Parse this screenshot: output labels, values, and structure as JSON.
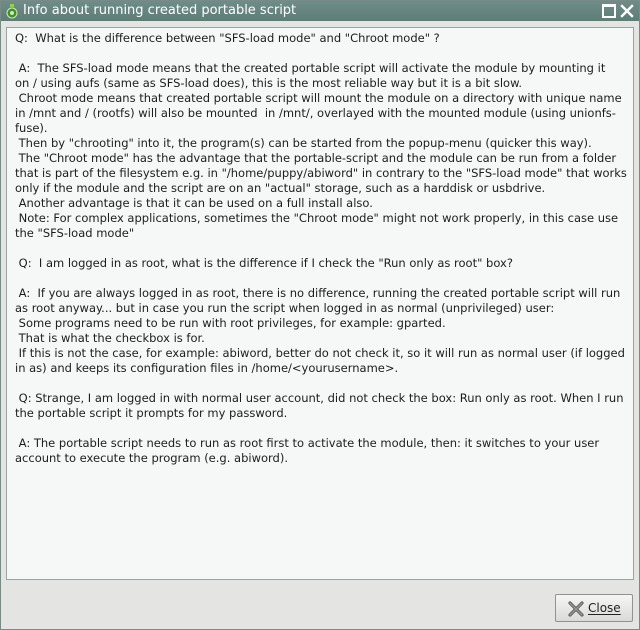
{
  "window": {
    "title": "Info about running created portable script"
  },
  "content": {
    "lines": [
      "Q:  What is the difference between \"SFS-load mode\" and \"Chroot mode\" ?",
      "",
      " A:  The SFS-load mode means that the created portable script will activate the module by mounting it",
      "on / using aufs (same as SFS-load does), this is the most reliable way but it is a bit slow.",
      " Chroot mode means that created portable script will mount the module on a directory with unique name",
      "in /mnt and / (rootfs) will also be mounted  in /mnt/, overlayed with the mounted module (using unionfs-",
      "fuse).",
      " Then by \"chrooting\" into it, the program(s) can be started from the popup-menu (quicker this way).",
      " The \"Chroot mode\" has the advantage that the portable-script and the module can be run from a folder",
      "that is part of the filesystem e.g. in \"/home/puppy/abiword\" in contrary to the \"SFS-load mode\" that works",
      "only if the module and the script are on an \"actual\" storage, such as a harddisk or usbdrive.",
      " Another advantage is that it can be used on a full install also.",
      " Note: For complex applications, sometimes the \"Chroot mode\" might not work properly, in this case use",
      "the \"SFS-load mode\"",
      "",
      " Q:  I am logged in as root, what is the difference if I check the \"Run only as root\" box?",
      "",
      " A:  If you are always logged in as root, there is no difference, running the created portable script will run",
      "as root anyway... but in case you run the script when logged in as normal (unprivileged) user:",
      " Some programs need to be run with root privileges, for example: gparted.",
      " That is what the checkbox is for.",
      " If this is not the case, for example: abiword, better do not check it, so it will run as normal user (if logged",
      "in as) and keeps its configuration files in /home/<yourusername>.",
      "",
      " Q: Strange, I am logged in with normal user account, did not check the box: Run only as root. When I run",
      "the portable script it prompts for my password.",
      "",
      " A: The portable script needs to run as root first to activate the module, then: it switches to your user",
      "account to execute the program (e.g. abiword)."
    ]
  },
  "buttons": {
    "close_label": "Close"
  },
  "icons": {
    "title_icon": "puppy-app-icon",
    "maximize": "maximize-icon",
    "close_window": "close-icon",
    "close_button": "close-x-icon"
  },
  "colors": {
    "titlebar": "#667f7a",
    "content_bg": "#f5f8f7"
  }
}
